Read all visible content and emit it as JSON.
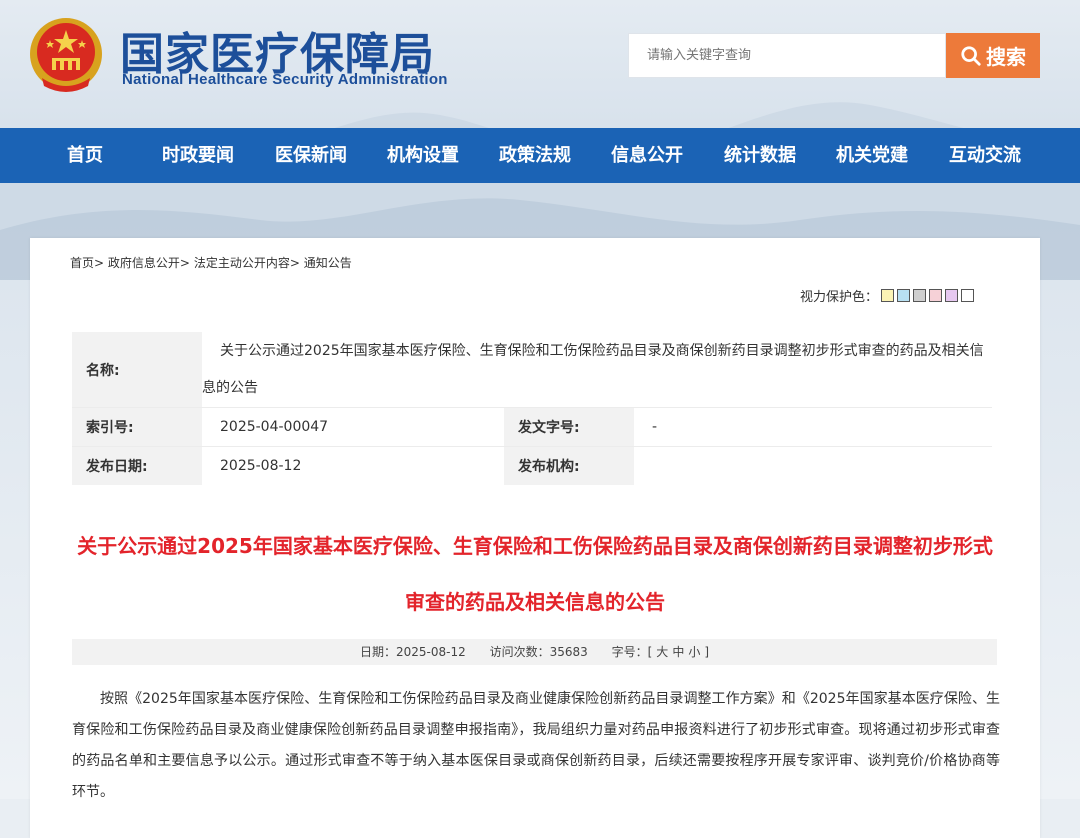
{
  "header": {
    "title_cn": "国家医疗保障局",
    "title_en": "National Healthcare Security Administration",
    "search_placeholder": "请输入关键字查询",
    "search_button": "搜索",
    "emblem_icon": "national-emblem-icon"
  },
  "nav": {
    "items": [
      "首页",
      "时政要闻",
      "医保新闻",
      "机构设置",
      "政策法规",
      "信息公开",
      "统计数据",
      "机关党建",
      "互动交流"
    ],
    "bg_color": "#1b63b5"
  },
  "breadcrumb": {
    "items": [
      "首页",
      "政府信息公开",
      "法定主动公开内容",
      "通知公告"
    ],
    "separator": ">"
  },
  "vision": {
    "label": "视力保护色：",
    "colors": [
      "#fbf3b5",
      "#b8e0f2",
      "#cfcfcf",
      "#f6d1d7",
      "#e6c8f0",
      "#ffffff"
    ]
  },
  "meta": {
    "name_label": "名称:",
    "name_value": "关于公示通过2025年国家基本医疗保险、生育保险和工伤保险药品目录及商保创新药目录调整初步形式审查的药品及相关信息的公告",
    "index_label": "索引号:",
    "index_value": "2025-04-00047",
    "docno_label": "发文字号:",
    "docno_value": "-",
    "date_label": "发布日期:",
    "date_value": "2025-08-12",
    "org_label": "发布机构:",
    "org_value": ""
  },
  "article": {
    "title": "关于公示通过2025年国家基本医疗保险、生育保险和工伤保险药品目录及商保创新药目录调整初步形式审查的药品及相关信息的公告",
    "title_color": "#e3242b",
    "date_label": "日期：",
    "date": "2025-08-12",
    "visits_label": "访问次数：",
    "visits": "35683",
    "size_label": "字号：",
    "size_open": "[",
    "size_big": "大",
    "size_mid": "中",
    "size_small": "小",
    "size_close": "]",
    "body": "按照《2025年国家基本医疗保险、生育保险和工伤保险药品目录及商业健康保险创新药品目录调整工作方案》和《2025年国家基本医疗保险、生育保险和工伤保险药品目录及商业健康保险创新药品目录调整申报指南》，我局组织力量对药品申报资料进行了初步形式审查。现将通过初步形式审查的药品名单和主要信息予以公示。通过形式审查不等于纳入基本医保目录或商保创新药目录，后续还需要按程序开展专家评审、谈判竞价/价格协商等环节。"
  }
}
